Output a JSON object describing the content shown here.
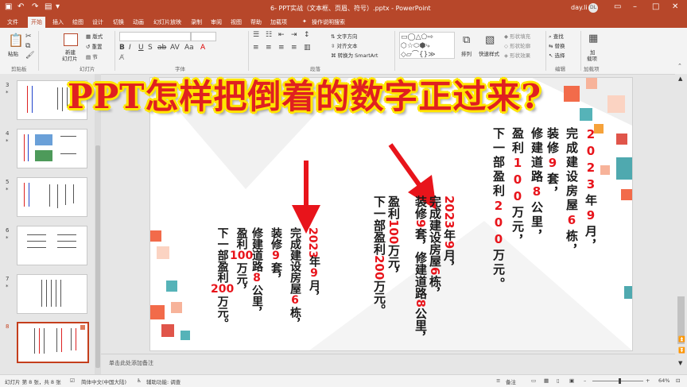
{
  "titlebar": {
    "doc_title": "6- PPT实战（文本框、页眉、符号）.pptx - PowerPoint",
    "user_name": "day.li",
    "user_initials": "DL"
  },
  "tabs": [
    "文件",
    "开始",
    "插入",
    "绘图",
    "设计",
    "切换",
    "动画",
    "幻灯片放映",
    "录制",
    "审阅",
    "视图",
    "帮助",
    "加载项"
  ],
  "tell_me": "操作说明搜索",
  "ribbon": {
    "paste": "粘贴",
    "new_slide_line1": "新建",
    "new_slide_line2": "幻灯片",
    "layout": "版式",
    "reset": "重置",
    "section": "节",
    "text_direction": "文字方向",
    "align_text": "对齐文本",
    "convert_smartart": "转换为 SmartArt",
    "arrange": "排列",
    "quick_styles": "快速样式",
    "shape_fill": "形状填充",
    "shape_outline": "形状轮廓",
    "shape_effects": "形状效果",
    "find": "查找",
    "replace": "替换",
    "select": "选择",
    "addins_line1": "加",
    "addins_line2": "载项",
    "groups": {
      "clipboard": "剪贴板",
      "slides": "幻灯片",
      "font": "字体",
      "paragraph": "段落",
      "editing": "编辑",
      "addins": "加载项"
    }
  },
  "thumbnails": [
    {
      "num": "3",
      "star": "*"
    },
    {
      "num": "4",
      "star": "*"
    },
    {
      "num": "5",
      "star": "*"
    },
    {
      "num": "6",
      "star": "*"
    },
    {
      "num": "7",
      "star": "*"
    },
    {
      "num": "8",
      "star": ""
    }
  ],
  "caption": "PPT怎样把倒着的数字正过来?",
  "slide": {
    "group1": [
      {
        "pre": "",
        "red": "2023",
        "post": ""
      },
      {
        "pre": "年",
        "red": "9",
        "post": "月，"
      },
      {
        "pre": "完成建设房屋",
        "red": "6",
        "post": "栋，"
      },
      {
        "pre": "装修",
        "red": "9",
        "post": "套，"
      },
      {
        "pre": "修建道路",
        "red": "8",
        "post": "公里，"
      },
      {
        "pre": "盈利",
        "red": "100",
        "post": "万元，"
      },
      {
        "pre": "下一部盈利",
        "red": "200",
        "post": "万元。"
      }
    ],
    "group2": [
      {
        "pre": "",
        "red": "2023",
        "post": "年"
      },
      {
        "pre": "",
        "red": "9",
        "post": "月，"
      },
      {
        "pre": "完成建设房屋",
        "red": "6",
        "post": "栋，"
      },
      {
        "pre": "装修",
        "red": "9",
        "post": "套，"
      },
      {
        "pre": "修建道路",
        "red": "8",
        "post": "公里，"
      },
      {
        "pre": "盈利",
        "red": "100",
        "post": "万元，"
      },
      {
        "pre": "下一部盈利",
        "red": "200",
        "post": "万元。"
      }
    ],
    "group3": [
      {
        "pre": "",
        "red": "2023",
        "post": "年"
      },
      {
        "pre": "",
        "red": "9",
        "post": "月，"
      },
      {
        "pre": "完成建设房屋",
        "red": "6",
        "post": "栋，"
      },
      {
        "pre": "装修",
        "red": "9",
        "post": "套，"
      },
      {
        "pre": "修建道路",
        "red": "8",
        "post": "公里，"
      },
      {
        "pre": "盈利",
        "red": "100",
        "post": "万元，"
      },
      {
        "pre": "下一部盈利",
        "red": "200",
        "post": "万元。"
      }
    ]
  },
  "notes_placeholder": "单击此处添加备注",
  "status": {
    "slide_info": "幻灯片 第 8 张，共 8 张",
    "language": "简体中文(中国大陆)",
    "accessibility": "辅助功能: 调查",
    "notes": "备注",
    "zoom": "64%"
  },
  "colors": {
    "accent": "#b7472a",
    "highlight": "#e8141b",
    "caption_outline": "#ffe600"
  }
}
